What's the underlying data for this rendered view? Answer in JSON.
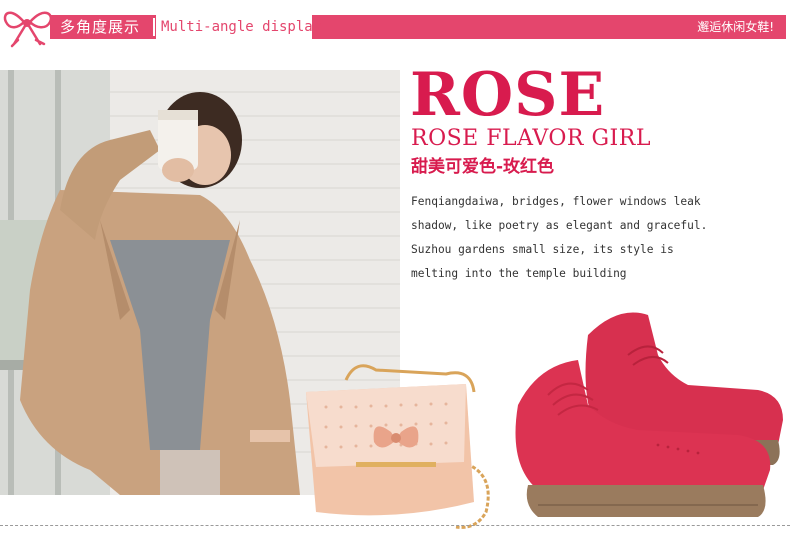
{
  "banner": {
    "title_cn": "多角度展示",
    "title_en": "Multi-angle display",
    "right_text": "邂逅休闲女鞋!"
  },
  "product": {
    "title": "ROSE",
    "subtitle": "ROSE FLAVOR GIRL",
    "subtitle_cn": "甜美可爱色-玫红色",
    "description": [
      "Fenqiangdaiwa, bridges, flower windows leak",
      "shadow, like poetry as elegant and graceful.",
      "Suzhou gardens small size, its style is",
      "melting into the temple building"
    ]
  },
  "colors": {
    "accent": "#e4466d",
    "title": "#d81b4e",
    "shoe": "#d7304f"
  }
}
